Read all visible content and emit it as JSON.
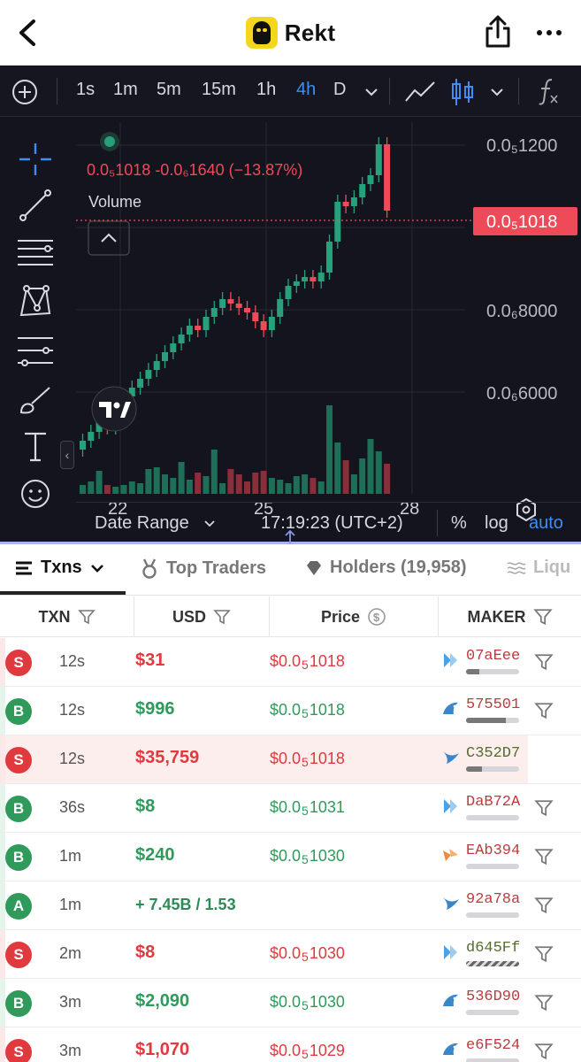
{
  "header": {
    "title": "Rekt"
  },
  "toolbar": {
    "intervals": [
      "1s",
      "1m",
      "5m",
      "15m",
      "1h",
      "4h",
      "D"
    ],
    "active_interval": "4h"
  },
  "chart": {
    "ohlc_text": "0.0₅1018  -0.0₆1640 (−13.87%)",
    "volume_label": "Volume",
    "price_ticks": [
      "0.0₅1200",
      "0.0₆8000",
      "0.0₆6000"
    ],
    "current_price": "0.0₅1018",
    "x_ticks": [
      "22",
      "25",
      "28"
    ],
    "colors": {
      "up": "#26a17b",
      "down": "#ef4a58",
      "bg": "#13141d",
      "accent": "#3e8ef7"
    }
  },
  "chart_data": {
    "type": "candlestick",
    "x_ticks": [
      "22",
      "25",
      "28"
    ],
    "last_price": "0.0₅1018",
    "change": "-0.0₆1640",
    "change_pct": "−13.87%",
    "series": [
      {
        "name": "price",
        "values": [
          0.5,
          0.52,
          0.55,
          0.53,
          0.56,
          0.6,
          0.62,
          0.64,
          0.66,
          0.68,
          0.7,
          0.72,
          0.74,
          0.76,
          0.75,
          0.78,
          0.8,
          0.82,
          0.81,
          0.8,
          0.79,
          0.77,
          0.75,
          0.78,
          0.82,
          0.85,
          0.86,
          0.87,
          0.86,
          0.88,
          0.95,
          1.04,
          1.03,
          1.05,
          1.08,
          1.1,
          1.17,
          1.02
        ]
      }
    ]
  },
  "bottombar": {
    "date_range": "Date Range",
    "time": "17:19:23 (UTC+2)",
    "pct": "%",
    "log": "log",
    "auto": "auto"
  },
  "tabs": [
    {
      "label": "Txns"
    },
    {
      "label": "Top Traders"
    },
    {
      "label": "Holders (19,958)"
    },
    {
      "label": "Liqu"
    }
  ],
  "table": {
    "headers": [
      "TXN",
      "USD",
      "Price",
      "MAKER"
    ],
    "rows": [
      {
        "type": "S",
        "age": "12s",
        "usd": "$31",
        "price_a": "$0.0",
        "price_sub": "5",
        "price_b": "1018",
        "maker": "07aEee",
        "fill": 0.25
      },
      {
        "type": "B",
        "age": "12s",
        "usd": "$996",
        "price_a": "$0.0",
        "price_sub": "5",
        "price_b": "1018",
        "maker": "575501",
        "fill": 0.75
      },
      {
        "type": "S",
        "age": "12s",
        "usd": "$35,759",
        "price_a": "$0.0",
        "price_sub": "5",
        "price_b": "1018",
        "maker": "C352D7",
        "fill": 0.3
      },
      {
        "type": "B",
        "age": "36s",
        "usd": "$8",
        "price_a": "$0.0",
        "price_sub": "5",
        "price_b": "1031",
        "maker": "DaB72A",
        "fill": 0.0
      },
      {
        "type": "B",
        "age": "1m",
        "usd": "$240",
        "price_a": "$0.0",
        "price_sub": "5",
        "price_b": "1030",
        "maker": "EAb394",
        "fill": 0.0
      },
      {
        "type": "A",
        "age": "1m",
        "amount": "+ 7.45B / 1.53",
        "maker": "92a78a",
        "fill": 0.0
      },
      {
        "type": "S",
        "age": "2m",
        "usd": "$8",
        "price_a": "$0.0",
        "price_sub": "5",
        "price_b": "1030",
        "maker": "d645Ff",
        "fill": 1.0
      },
      {
        "type": "B",
        "age": "3m",
        "usd": "$2,090",
        "price_a": "$0.0",
        "price_sub": "5",
        "price_b": "1030",
        "maker": "536D90",
        "fill": 0.0
      },
      {
        "type": "S",
        "age": "3m",
        "usd": "$1,070",
        "price_a": "$0.0",
        "price_sub": "5",
        "price_b": "1029",
        "maker": "e6F524",
        "fill": 0.0
      }
    ]
  }
}
